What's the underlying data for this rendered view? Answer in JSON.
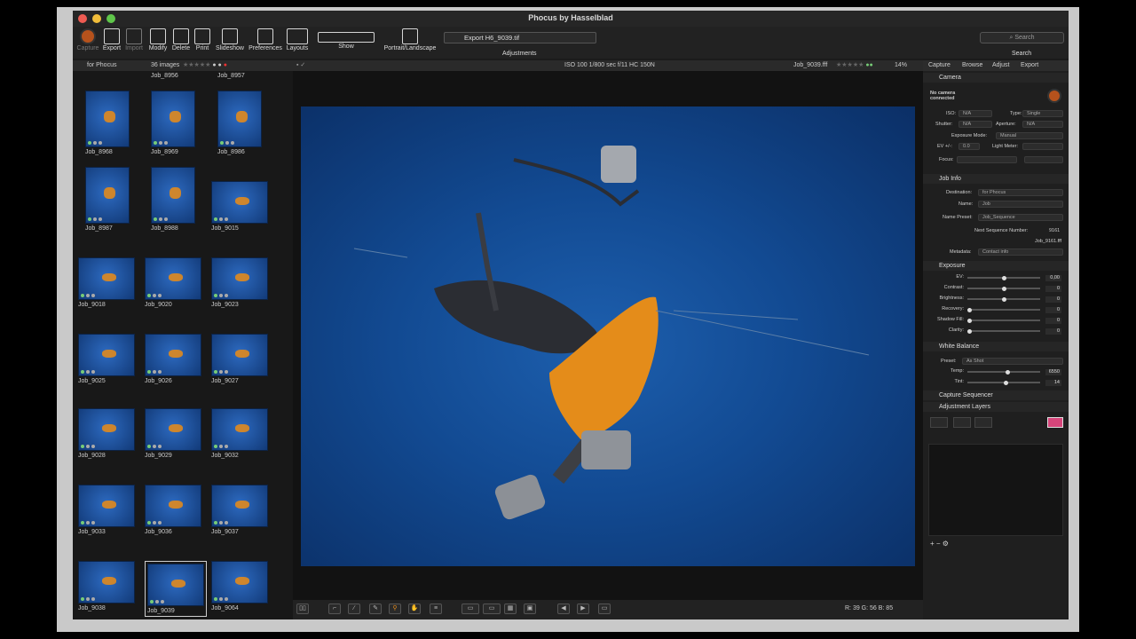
{
  "window": {
    "title": "Phocus by Hasselblad"
  },
  "toolbar": {
    "capture": "Capture",
    "export": "Export",
    "import": "Import",
    "modify": "Modify",
    "delete": "Delete",
    "print": "Print",
    "slideshow": "Slideshow",
    "preferences": "Preferences",
    "layouts": "Layouts",
    "show": "Show",
    "portrait": "Portrait/Landscape",
    "adjustments": "Adjustments",
    "search_label": "Search",
    "export_field": "Export H6_9039.tif",
    "search_placeholder": "Search"
  },
  "browser": {
    "folder": "for Phocus",
    "count": "36 images",
    "top_labels": [
      "Job_8956",
      "Job_8957"
    ],
    "thumbs": [
      "Job_8968",
      "Job_8969",
      "Job_8986",
      "Job_8987",
      "Job_8988",
      "Job_9015",
      "Job_9018",
      "Job_9020",
      "Job_9023",
      "Job_9025",
      "Job_9026",
      "Job_9027",
      "Job_9028",
      "Job_9029",
      "Job_9032",
      "Job_9033",
      "Job_9036",
      "Job_9037",
      "Job_9038",
      "Job_9039",
      "Job_9064"
    ]
  },
  "viewer": {
    "info": "ISO 100   1/800 sec   f/11   HC 150N",
    "filename": "Job_9039.fff",
    "zoom": "14%",
    "rgb": "R:  39  G:  56  B:  85"
  },
  "right": {
    "tabs": [
      "Capture",
      "Browse",
      "Adjust",
      "Export"
    ],
    "camera": {
      "title": "Camera",
      "status": "No camera connected",
      "iso_label": "ISO:",
      "iso": "N/A",
      "type_label": "Type:",
      "type": "Single",
      "shutter_label": "Shutter:",
      "shutter": "N/A",
      "aperture_label": "Aperture:",
      "aperture": "N/A",
      "mode_label": "Exposure Mode:",
      "mode": "Manual",
      "ev_label": "EV +/-:",
      "ev": "0.0",
      "meter_label": "Light Meter:",
      "focus_label": "Focus:"
    },
    "jobinfo": {
      "title": "Job Info",
      "dest_label": "Destination:",
      "dest": "for Phocus",
      "name_label": "Name:",
      "name": "Job",
      "preset_label": "Name Preset:",
      "preset": "Job_Sequence",
      "next_label": "Next Sequence Number:",
      "next": "9161",
      "next_file": "Job_9161.fff",
      "meta_label": "Metadata:",
      "meta": "Contact info"
    },
    "exposure": {
      "title": "Exposure",
      "sliders": [
        {
          "label": "EV:",
          "value": "0,00",
          "pos": 0.5
        },
        {
          "label": "Contrast:",
          "value": "0",
          "pos": 0.5
        },
        {
          "label": "Brightness:",
          "value": "0",
          "pos": 0.5
        },
        {
          "label": "Recovery:",
          "value": "0",
          "pos": 0.02
        },
        {
          "label": "Shadow Fill:",
          "value": "0",
          "pos": 0.02
        },
        {
          "label": "Clarity:",
          "value": "0",
          "pos": 0.02
        }
      ]
    },
    "wb": {
      "title": "White Balance",
      "preset_label": "Preset:",
      "preset": "As Shot",
      "sliders": [
        {
          "label": "Temp:",
          "value": "6550",
          "pos": 0.55
        },
        {
          "label": "Tint:",
          "value": "14",
          "pos": 0.53
        }
      ]
    },
    "seq": {
      "title": "Capture Sequencer"
    },
    "layers": {
      "title": "Adjustment Layers"
    }
  },
  "colors": {
    "accent": "#e08a1e",
    "photo_bg": "#124a92",
    "capture": "#b6521c"
  }
}
